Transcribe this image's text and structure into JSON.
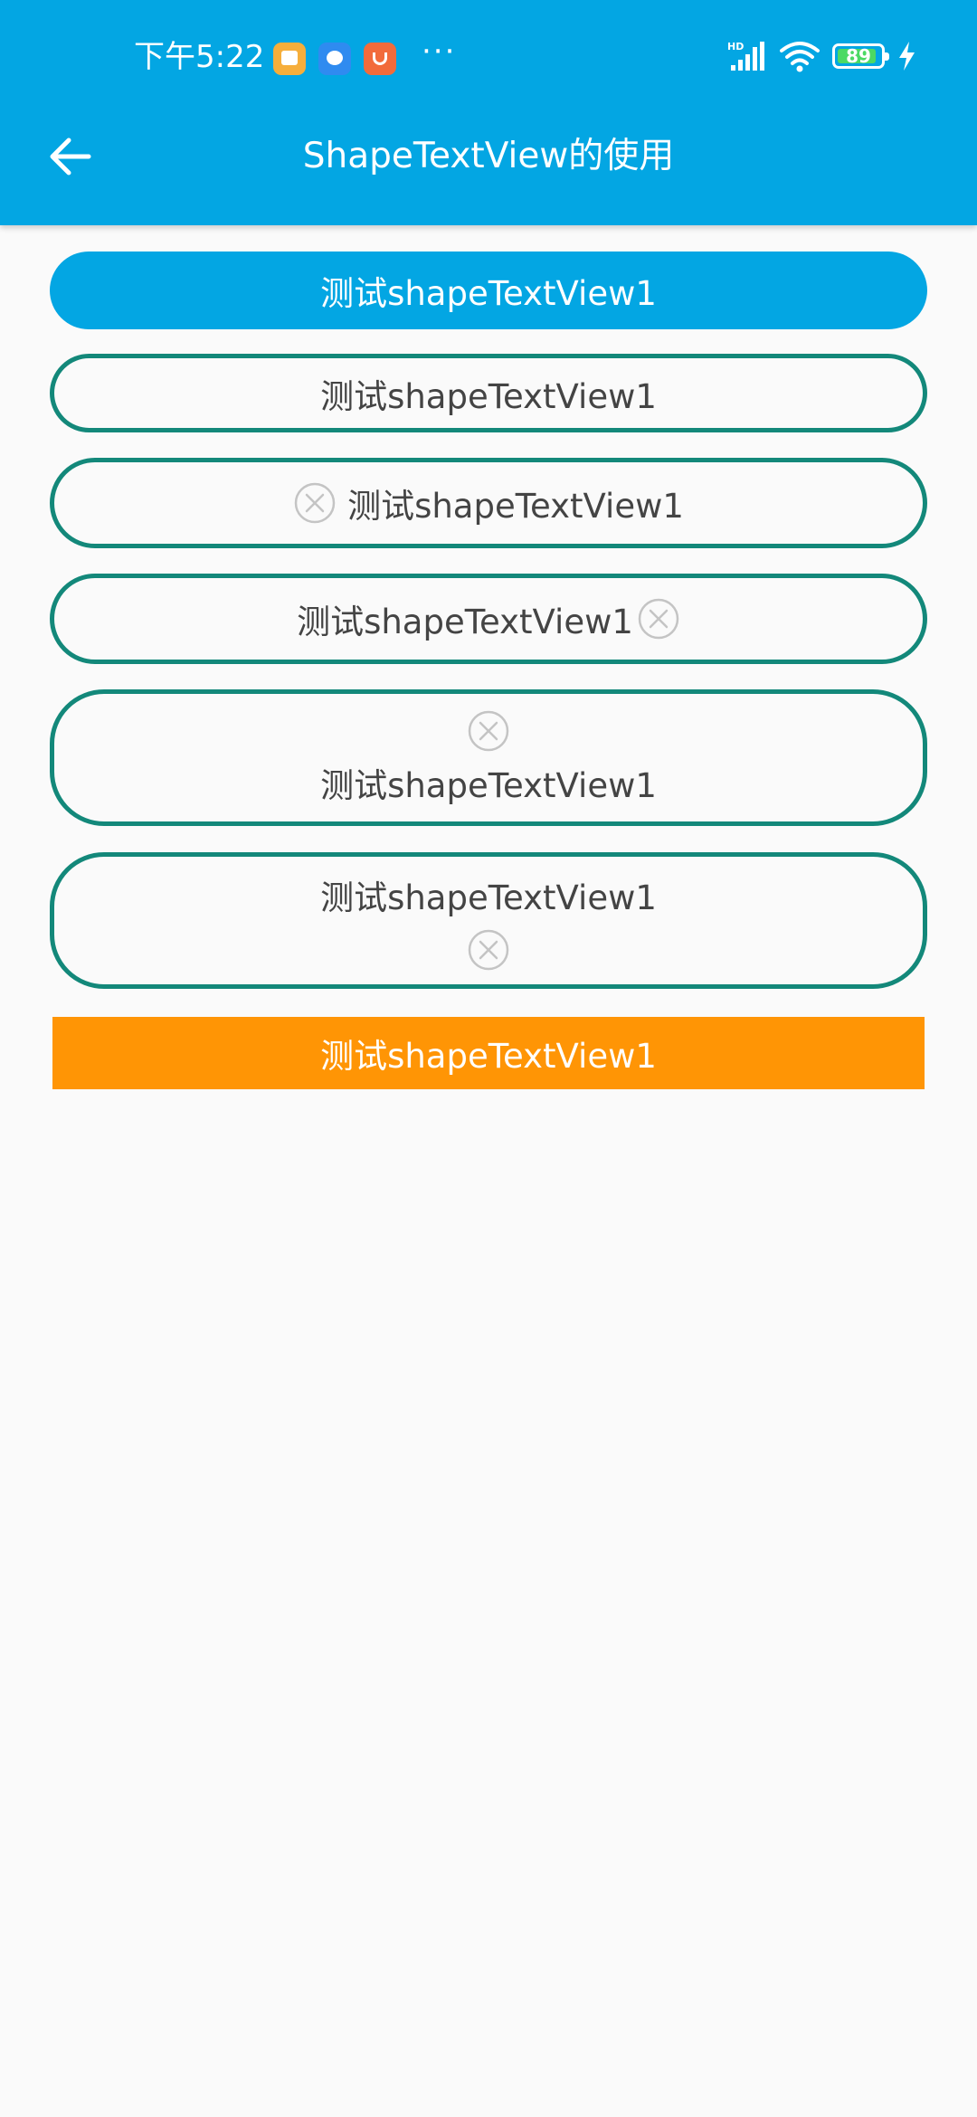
{
  "status_bar": {
    "time": "下午5:22",
    "more": "···",
    "battery_level": "89",
    "icons": [
      "message-app-icon",
      "chat-app-icon",
      "store-app-icon",
      "hd-signal-icon",
      "wifi-icon",
      "battery-icon",
      "charging-icon"
    ]
  },
  "toolbar": {
    "back_icon": "arrow-left-icon",
    "title": "ShapeTextView的使用"
  },
  "buttons": {
    "b1": "测试shapeTextView1",
    "b2": "测试shapeTextView1",
    "b3": "测试shapeTextView1",
    "b4": "测试shapeTextView1",
    "b5": "测试shapeTextView1",
    "b6": "测试shapeTextView1",
    "b7": "测试shapeTextView1"
  },
  "colors": {
    "primary": "#03a6e3",
    "stroke": "#13887a",
    "orange": "#ff9505",
    "background": "#fafafa"
  }
}
